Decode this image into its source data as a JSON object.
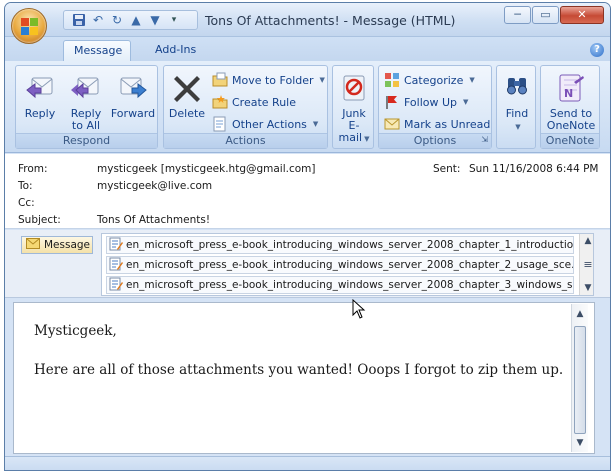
{
  "window": {
    "title": "Tons Of Attachments! - Message (HTML)",
    "controls": {
      "minimize": "─",
      "maximize": "▭",
      "close": "✕"
    }
  },
  "tabs": [
    {
      "label": "Message",
      "active": true
    },
    {
      "label": "Add-Ins",
      "active": false
    }
  ],
  "ribbon": {
    "respond": {
      "label": "Respond",
      "reply": [
        "Reply"
      ],
      "reply_all": [
        "Reply",
        "to All"
      ],
      "forward": [
        "Forward"
      ]
    },
    "actions": {
      "label": "Actions",
      "delete": "Delete",
      "move_to_folder": "Move to Folder",
      "create_rule": "Create Rule",
      "other_actions": "Other Actions"
    },
    "junk": {
      "line1": "Junk",
      "line2": "E-mail"
    },
    "options": {
      "label": "Options",
      "categorize": "Categorize",
      "follow_up": "Follow Up",
      "mark_as_unread": "Mark as Unread"
    },
    "find": {
      "label": "Find"
    },
    "onenote": {
      "label": "OneNote",
      "line1": "Send to",
      "line2": "OneNote"
    }
  },
  "header": {
    "from_label": "From:",
    "from_value": "mysticgeek [mysticgeek.htg@gmail.com]",
    "to_label": "To:",
    "to_value": "mysticgeek@live.com",
    "cc_label": "Cc:",
    "cc_value": "",
    "subject_label": "Subject:",
    "subject_value": "Tons Of Attachments!",
    "sent_label": "Sent:",
    "sent_value": "Sun 11/16/2008 6:44 PM"
  },
  "attachments": {
    "message_label": "Message",
    "items": [
      "en_microsoft_press_e-book_introducing_windows_server_2008_chapter_1_introductio...",
      "en_microsoft_press_e-book_introducing_windows_server_2008_chapter_2_usage_sce...",
      "en_microsoft_press_e-book_introducing_windows_server_2008_chapter_3_windows_s..."
    ]
  },
  "body": {
    "greeting": "Mysticgeek,",
    "line1": "Here are all of those attachments you wanted!  Ooops I forgot to zip them up."
  },
  "colors": {
    "accent": "#15428b",
    "ribbon": "#d3e2f5",
    "close": "#c64a35"
  }
}
